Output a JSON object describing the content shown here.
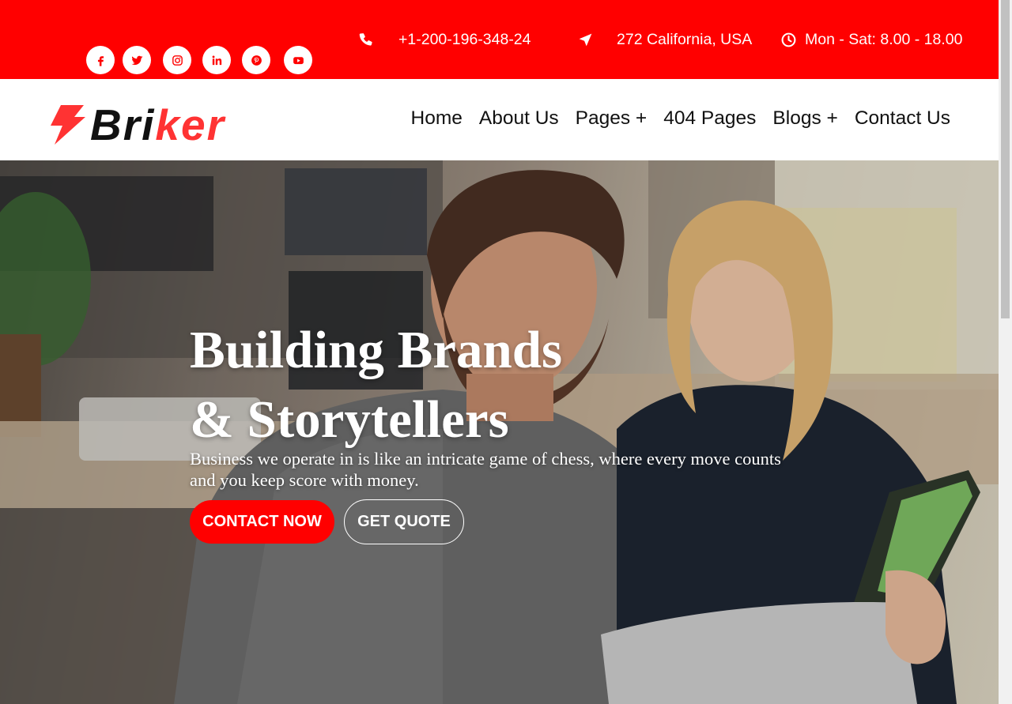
{
  "topbar": {
    "background": "#ff0000",
    "social": [
      {
        "name": "facebook-icon"
      },
      {
        "name": "twitter-icon"
      },
      {
        "name": "instagram-icon"
      },
      {
        "name": "linkedin-icon"
      },
      {
        "name": "pinterest-icon"
      },
      {
        "name": "youtube-icon"
      }
    ],
    "phone": {
      "icon": "phone-icon",
      "text": "+1-200-196-348-24"
    },
    "address": {
      "icon": "location-arrow-icon",
      "text": "272 California, USA"
    },
    "hours": {
      "icon": "clock-icon",
      "text": "Mon - Sat: 8.00 - 18.00"
    }
  },
  "header": {
    "logo": {
      "icon": "lightning-bolt-icon",
      "part1": "Bri",
      "part2": "ker",
      "accent": "#ff3333"
    },
    "nav": [
      "Home",
      "About Us",
      "Pages +",
      "404 Pages",
      "Blogs +",
      "Contact Us"
    ]
  },
  "hero": {
    "title_line1": "Building Brands",
    "title_line2": "& Storytellers",
    "text": "Business we operate in is like an intricate game of chess, where every move counts and you keep score with money.",
    "primary_button": "CONTACT NOW",
    "secondary_button": "GET QUOTE"
  }
}
